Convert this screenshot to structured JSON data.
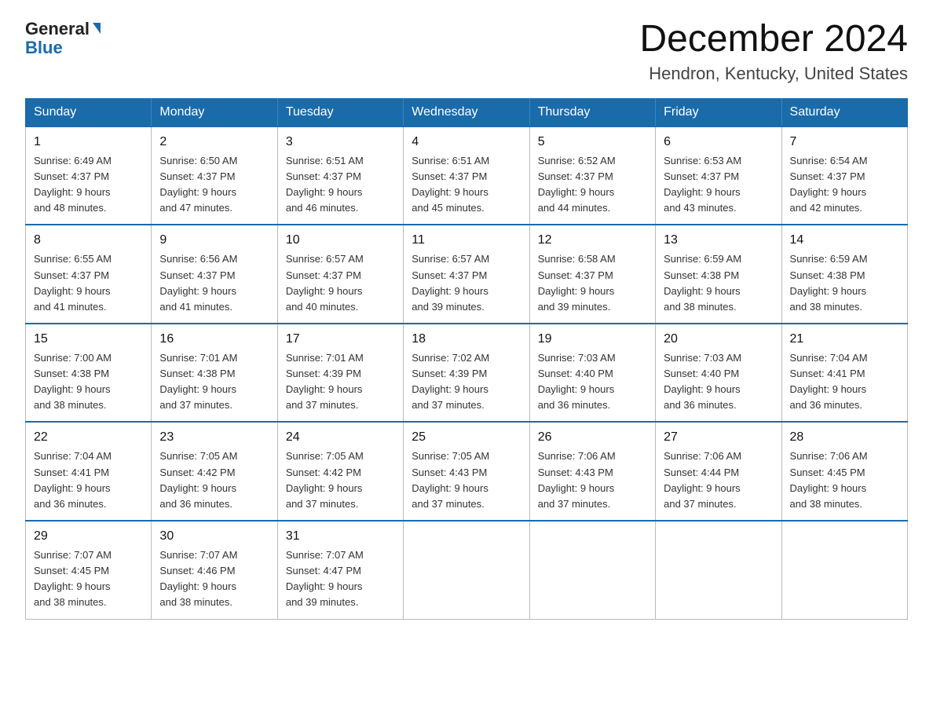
{
  "header": {
    "logo_general": "General",
    "logo_blue": "Blue",
    "main_title": "December 2024",
    "subtitle": "Hendron, Kentucky, United States"
  },
  "columns": [
    "Sunday",
    "Monday",
    "Tuesday",
    "Wednesday",
    "Thursday",
    "Friday",
    "Saturday"
  ],
  "weeks": [
    [
      {
        "num": "1",
        "sunrise": "6:49 AM",
        "sunset": "4:37 PM",
        "daylight": "9 hours and 48 minutes."
      },
      {
        "num": "2",
        "sunrise": "6:50 AM",
        "sunset": "4:37 PM",
        "daylight": "9 hours and 47 minutes."
      },
      {
        "num": "3",
        "sunrise": "6:51 AM",
        "sunset": "4:37 PM",
        "daylight": "9 hours and 46 minutes."
      },
      {
        "num": "4",
        "sunrise": "6:51 AM",
        "sunset": "4:37 PM",
        "daylight": "9 hours and 45 minutes."
      },
      {
        "num": "5",
        "sunrise": "6:52 AM",
        "sunset": "4:37 PM",
        "daylight": "9 hours and 44 minutes."
      },
      {
        "num": "6",
        "sunrise": "6:53 AM",
        "sunset": "4:37 PM",
        "daylight": "9 hours and 43 minutes."
      },
      {
        "num": "7",
        "sunrise": "6:54 AM",
        "sunset": "4:37 PM",
        "daylight": "9 hours and 42 minutes."
      }
    ],
    [
      {
        "num": "8",
        "sunrise": "6:55 AM",
        "sunset": "4:37 PM",
        "daylight": "9 hours and 41 minutes."
      },
      {
        "num": "9",
        "sunrise": "6:56 AM",
        "sunset": "4:37 PM",
        "daylight": "9 hours and 41 minutes."
      },
      {
        "num": "10",
        "sunrise": "6:57 AM",
        "sunset": "4:37 PM",
        "daylight": "9 hours and 40 minutes."
      },
      {
        "num": "11",
        "sunrise": "6:57 AM",
        "sunset": "4:37 PM",
        "daylight": "9 hours and 39 minutes."
      },
      {
        "num": "12",
        "sunrise": "6:58 AM",
        "sunset": "4:37 PM",
        "daylight": "9 hours and 39 minutes."
      },
      {
        "num": "13",
        "sunrise": "6:59 AM",
        "sunset": "4:38 PM",
        "daylight": "9 hours and 38 minutes."
      },
      {
        "num": "14",
        "sunrise": "6:59 AM",
        "sunset": "4:38 PM",
        "daylight": "9 hours and 38 minutes."
      }
    ],
    [
      {
        "num": "15",
        "sunrise": "7:00 AM",
        "sunset": "4:38 PM",
        "daylight": "9 hours and 38 minutes."
      },
      {
        "num": "16",
        "sunrise": "7:01 AM",
        "sunset": "4:38 PM",
        "daylight": "9 hours and 37 minutes."
      },
      {
        "num": "17",
        "sunrise": "7:01 AM",
        "sunset": "4:39 PM",
        "daylight": "9 hours and 37 minutes."
      },
      {
        "num": "18",
        "sunrise": "7:02 AM",
        "sunset": "4:39 PM",
        "daylight": "9 hours and 37 minutes."
      },
      {
        "num": "19",
        "sunrise": "7:03 AM",
        "sunset": "4:40 PM",
        "daylight": "9 hours and 36 minutes."
      },
      {
        "num": "20",
        "sunrise": "7:03 AM",
        "sunset": "4:40 PM",
        "daylight": "9 hours and 36 minutes."
      },
      {
        "num": "21",
        "sunrise": "7:04 AM",
        "sunset": "4:41 PM",
        "daylight": "9 hours and 36 minutes."
      }
    ],
    [
      {
        "num": "22",
        "sunrise": "7:04 AM",
        "sunset": "4:41 PM",
        "daylight": "9 hours and 36 minutes."
      },
      {
        "num": "23",
        "sunrise": "7:05 AM",
        "sunset": "4:42 PM",
        "daylight": "9 hours and 36 minutes."
      },
      {
        "num": "24",
        "sunrise": "7:05 AM",
        "sunset": "4:42 PM",
        "daylight": "9 hours and 37 minutes."
      },
      {
        "num": "25",
        "sunrise": "7:05 AM",
        "sunset": "4:43 PM",
        "daylight": "9 hours and 37 minutes."
      },
      {
        "num": "26",
        "sunrise": "7:06 AM",
        "sunset": "4:43 PM",
        "daylight": "9 hours and 37 minutes."
      },
      {
        "num": "27",
        "sunrise": "7:06 AM",
        "sunset": "4:44 PM",
        "daylight": "9 hours and 37 minutes."
      },
      {
        "num": "28",
        "sunrise": "7:06 AM",
        "sunset": "4:45 PM",
        "daylight": "9 hours and 38 minutes."
      }
    ],
    [
      {
        "num": "29",
        "sunrise": "7:07 AM",
        "sunset": "4:45 PM",
        "daylight": "9 hours and 38 minutes."
      },
      {
        "num": "30",
        "sunrise": "7:07 AM",
        "sunset": "4:46 PM",
        "daylight": "9 hours and 38 minutes."
      },
      {
        "num": "31",
        "sunrise": "7:07 AM",
        "sunset": "4:47 PM",
        "daylight": "9 hours and 39 minutes."
      },
      null,
      null,
      null,
      null
    ]
  ],
  "label_sunrise": "Sunrise:",
  "label_sunset": "Sunset:",
  "label_daylight": "Daylight:"
}
